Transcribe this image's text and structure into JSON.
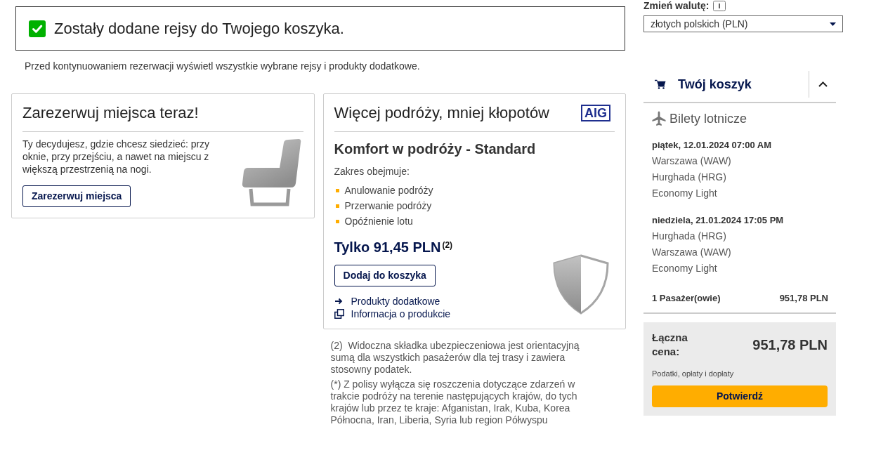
{
  "notification": {
    "message": "Zostały dodane rejsy do Twojego koszyka."
  },
  "intro": "Przed kontynuowaniem rezerwacji wyświetl wszystkie wybrane rejsy i produkty dodatkowe.",
  "seat_card": {
    "title": "Zarezerwuj miejsca teraz!",
    "description": "Ty decydujesz, gdzie chcesz siedzieć: przy oknie, przy przejściu, a nawet na miejscu z większą przestrzenią na nogi.",
    "button": "Zarezerwuj miejsca"
  },
  "insurance_card": {
    "title": "Więcej podróży, mniej kłopotów",
    "logo": "AIG",
    "product": "Komfort w podróży - Standard",
    "coverage_label": "Zakres obejmuje:",
    "coverage": [
      "Anulowanie podróży",
      "Przerwanie podróży",
      "Opóźnienie lotu"
    ],
    "price": "Tylko 91,45 PLN$^{(2)}$",
    "button": "Dodaj do koszyka",
    "links": [
      {
        "kind": "arrow",
        "label": "Produkty dodatkowe"
      },
      {
        "kind": "popup",
        "label": "Informacja o produkcie"
      }
    ]
  },
  "footnotes": [
    "(2)  Widoczna składka ubezpieczeniowa jest orientacyjną sumą dla wszystkich pasażerów dla tej trasy i zawiera stosowny podatek.",
    "(*) Z polisy wyłącza się roszczenia dotyczące zdarzeń w trakcie podróży na terenie następujących krajów, do tych krajów lub przez te kraje: Afganistan, Irak, Kuba, Korea Północna, Iran, Liberia, Syria lub region Półwyspu"
  ],
  "currency": {
    "label": "Zmień walutę:",
    "value": "złotych polskich (PLN)"
  },
  "cart": {
    "title": "Twój koszyk",
    "expanded": true,
    "section": "Bilety lotnicze",
    "flights": [
      {
        "date": "piątek, 12.01.2024 07:00 AM",
        "from": "Warszawa (WAW)",
        "to": "Hurghada (HRG)",
        "fare": "Economy Light"
      },
      {
        "date": "niedziela, 21.01.2024 17:05 PM",
        "from": "Hurghada (HRG)",
        "to": "Warszawa (WAW)",
        "fare": "Economy Light"
      }
    ],
    "passengers": "1 Pasażer(owie)",
    "passengers_price": "951,78 PLN",
    "total_label": "Łączna cena:",
    "total": "951,78 PLN",
    "taxes_note": "Podatki, opłaty i dopłaty",
    "confirm_button": "Potwierdź"
  }
}
